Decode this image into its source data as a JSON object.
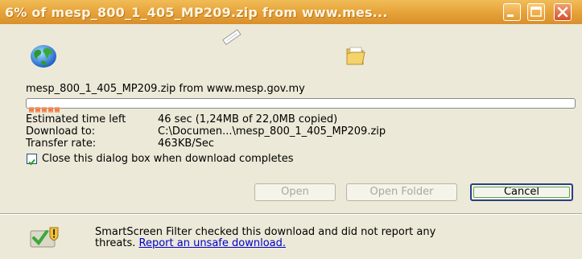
{
  "window": {
    "title": "6% of mesp_800_1_405_MP209.zip from www.mes..."
  },
  "download": {
    "header": "mesp_800_1_405_MP209.zip from www.mesp.gov.my",
    "progress_percent": 6,
    "estimated_label": "Estimated time left",
    "estimated_value": "46 sec (1,24MB of 22,0MB copied)",
    "download_to_label": "Download to:",
    "download_to_value": "C:\\Documen...\\mesp_800_1_405_MP209.zip",
    "transfer_rate_label": "Transfer rate:",
    "transfer_rate_value": "463KB/Sec"
  },
  "close_option": {
    "label": "Close this dialog box when download completes",
    "checked": true
  },
  "buttons": {
    "open": "Open",
    "open_folder": "Open Folder",
    "cancel": "Cancel"
  },
  "smartscreen": {
    "message": "SmartScreen Filter checked this download and did not report any",
    "message_line2": "threats.",
    "link": "Report an unsafe download."
  },
  "icons": {
    "title_buttons": [
      "minimize-icon",
      "maximize-icon",
      "close-icon"
    ],
    "source": "globe-icon",
    "transfer": "flying-document-icon",
    "destination": "folder-icon",
    "status": "shield-check-icon"
  },
  "colors": {
    "titlebar": "#e8a63c",
    "progress_fill": "#f07038",
    "dialog_bg": "#ece9d8",
    "link": "#0000cc"
  }
}
